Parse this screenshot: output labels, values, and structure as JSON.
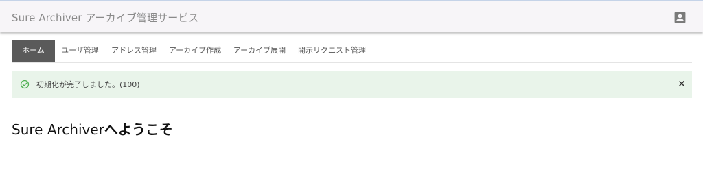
{
  "header": {
    "title": "Sure Archiver アーカイブ管理サービス",
    "account_icon": "account-box-icon"
  },
  "nav": {
    "tabs": [
      {
        "label": "ホーム",
        "active": true
      },
      {
        "label": "ユーザ管理",
        "active": false
      },
      {
        "label": "アドレス管理",
        "active": false
      },
      {
        "label": "アーカイブ作成",
        "active": false
      },
      {
        "label": "アーカイブ展開",
        "active": false
      },
      {
        "label": "開示リクエスト管理",
        "active": false
      }
    ]
  },
  "alert": {
    "icon": "check-circle-icon",
    "message": "初期化が完了しました。(100)",
    "close_label": "×",
    "color": "#e9f4ea",
    "icon_color": "#4caf50"
  },
  "main": {
    "welcome_prefix": "Sure Archiver",
    "welcome_suffix": "へようこそ"
  }
}
